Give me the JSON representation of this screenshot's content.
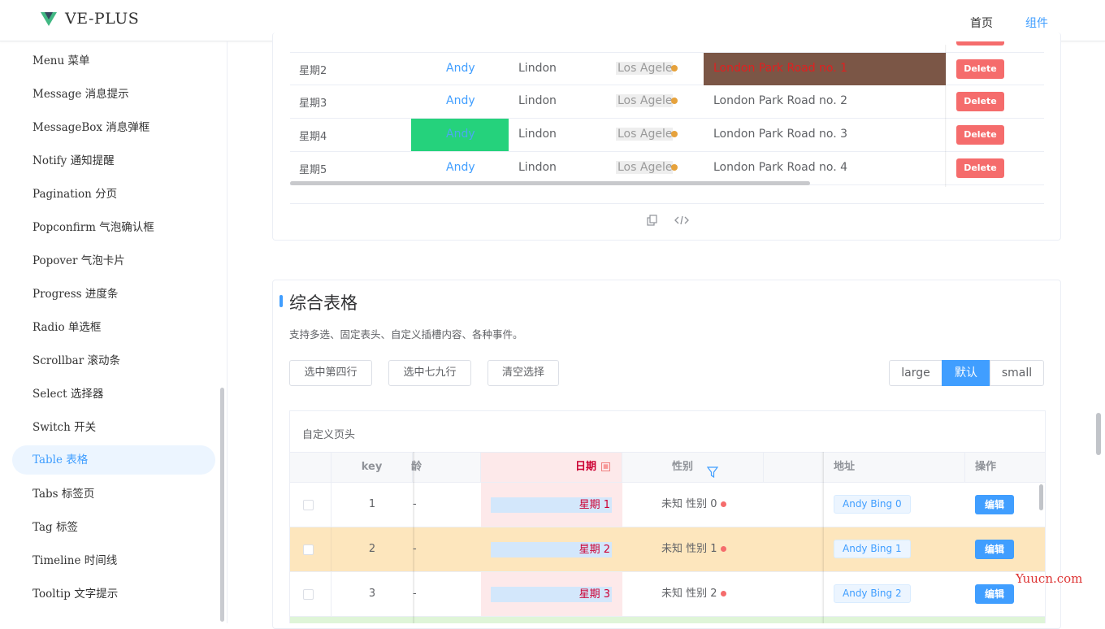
{
  "header": {
    "brand": "VE-PLUS",
    "nav": [
      "首页",
      "组件"
    ]
  },
  "sidebar": {
    "items": [
      {
        "label": "Menu 菜单"
      },
      {
        "label": "Message 消息提示"
      },
      {
        "label": "MessageBox 消息弹框"
      },
      {
        "label": "Notify 通知提醒"
      },
      {
        "label": "Pagination 分页"
      },
      {
        "label": "Popconfirm 气泡确认框"
      },
      {
        "label": "Popover 气泡卡片"
      },
      {
        "label": "Progress 进度条"
      },
      {
        "label": "Radio 单选框"
      },
      {
        "label": "Scrollbar 滚动条"
      },
      {
        "label": "Select 选择器"
      },
      {
        "label": "Switch 开关"
      },
      {
        "label": "Table 表格"
      },
      {
        "label": "Tabs 标签页"
      },
      {
        "label": "Tag 标签"
      },
      {
        "label": "Timeline 时间线"
      },
      {
        "label": "Tooltip 文字提示"
      }
    ],
    "active_index": 12
  },
  "table1": {
    "rows": [
      {
        "week": "星期2",
        "name": "Andy",
        "last": "Lindon",
        "city": "Los Agele.",
        "address": "London Park Road no. 1",
        "action": "Delete"
      },
      {
        "week": "星期3",
        "name": "Andy",
        "last": "Lindon",
        "city": "Los Agele.",
        "address": "London Park Road no. 2",
        "action": "Delete"
      },
      {
        "week": "星期4",
        "name": "Andy",
        "last": "Lindon",
        "city": "Los Agele.",
        "address": "London Park Road no. 3",
        "action": "Delete"
      },
      {
        "week": "星期5",
        "name": "Andy",
        "last": "Lindon",
        "city": "Los Agele.",
        "address": "London Park Road no. 4",
        "action": "Delete"
      }
    ],
    "highlight_address_color": "#7b5646",
    "highlight_name_color": "#25d27c"
  },
  "section": {
    "title": "综合表格",
    "desc": "支持多选、固定表头、自定义插槽内容、各种事件。",
    "buttons": [
      "选中第四行",
      "选中七九行",
      "清空选择"
    ],
    "sizes": [
      "large",
      "默认",
      "small"
    ],
    "size_active": "默认"
  },
  "table2": {
    "caption": "自定义页头",
    "headers": {
      "key": "key",
      "age": "龄",
      "date": "日期",
      "gender": "性别",
      "address": "地址",
      "action": "操作"
    },
    "rows": [
      {
        "key": "1",
        "date": "星期 1",
        "gender": "未知 性别 0",
        "address": "Andy Bing 0",
        "action": "编辑",
        "bg": "#ffffff"
      },
      {
        "key": "2",
        "date": "星期 2",
        "gender": "未知 性别 1",
        "address": "Andy Bing 1",
        "action": "编辑",
        "bg": "#fde6bd"
      },
      {
        "key": "3",
        "date": "星期 3",
        "gender": "未知 性别 2",
        "address": "Andy Bing 2",
        "action": "编辑",
        "bg": "#ffffff"
      }
    ],
    "dash": "-"
  },
  "watermark": "Yuucn.com"
}
